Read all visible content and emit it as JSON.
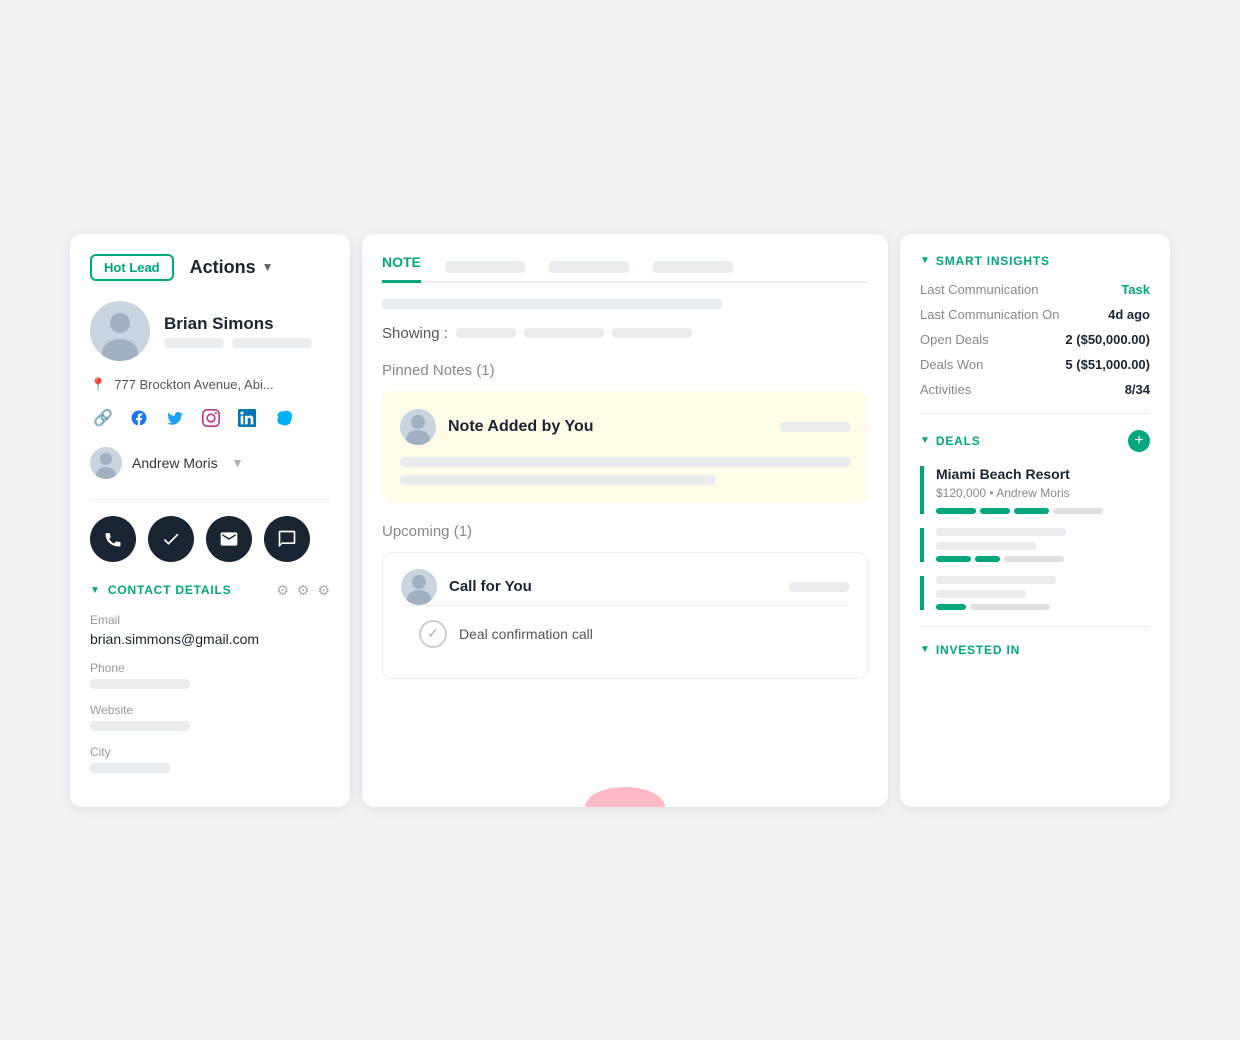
{
  "left": {
    "hot_lead": "Hot Lead",
    "actions": "Actions",
    "name": "Brian Simons",
    "address": "777 Brockton Avenue, Abi...",
    "assigned": "Andrew Moris",
    "contact_details_title": "CONTACT DETAILS",
    "email_label": "Email",
    "email_value": "brian.simmons@gmail.com",
    "phone_label": "Phone",
    "website_label": "Website",
    "city_label": "City"
  },
  "mid": {
    "tab_note": "NOTE",
    "tab2": "",
    "tab3": "",
    "tab4": "",
    "showing_label": "Showing :",
    "pinned_notes": "Pinned Notes (1)",
    "note_title": "Note Added by You",
    "upcoming": "Upcoming (1)",
    "call_title": "Call for You",
    "deal_confirm": "Deal confirmation call"
  },
  "right": {
    "smart_insights_title": "SMART INSIGHTS",
    "last_comm_label": "Last Communication",
    "last_comm_value": "Task",
    "last_comm_on_label": "Last Communication On",
    "last_comm_on_value": "4d ago",
    "open_deals_label": "Open Deals",
    "open_deals_value": "2 ($50,000.00)",
    "deals_won_label": "Deals Won",
    "deals_won_value": "5 ($51,000.00)",
    "activities_label": "Activities",
    "activities_value": "8/34",
    "deals_title": "DEALS",
    "deal1_name": "Miami Beach Resort",
    "deal1_sub": "$120,000 • Andrew Moris",
    "invested_title": "INVESTED IN"
  }
}
